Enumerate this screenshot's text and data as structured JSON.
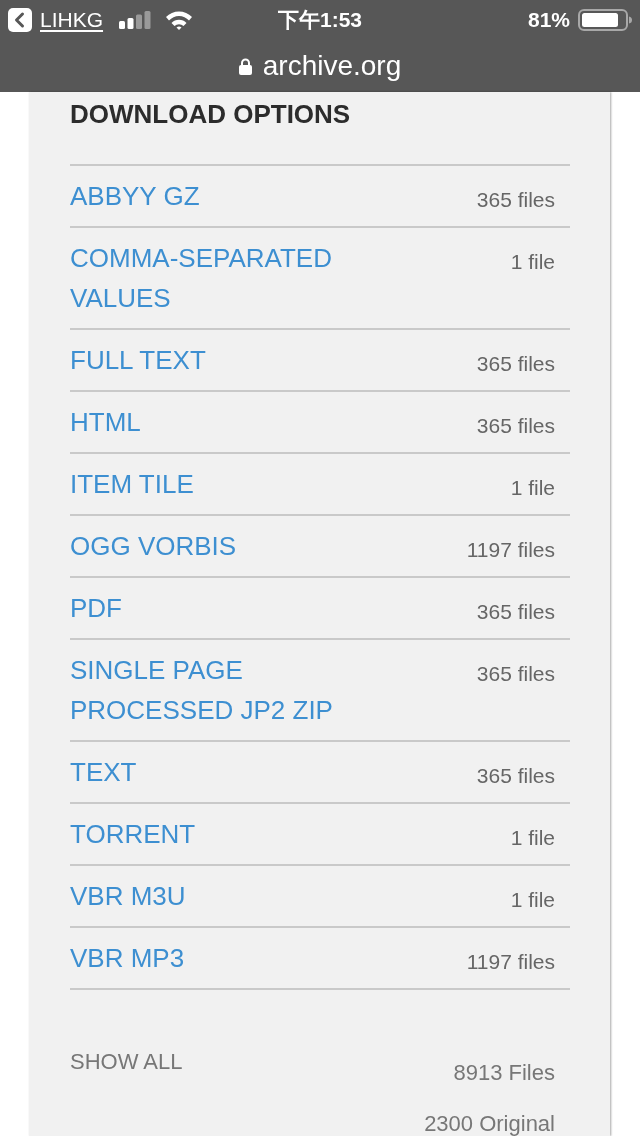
{
  "status_bar": {
    "back_label": "LIHKG",
    "time": "下午1:53",
    "battery": "81%"
  },
  "address_bar": {
    "url": "archive.org"
  },
  "download_options": {
    "title": "DOWNLOAD OPTIONS",
    "items": [
      {
        "name": "ABBYY GZ",
        "count": "365 files"
      },
      {
        "name": "COMMA-SEPARATED VALUES",
        "count": "1 file"
      },
      {
        "name": "FULL TEXT",
        "count": "365 files"
      },
      {
        "name": "HTML",
        "count": "365 files"
      },
      {
        "name": "ITEM TILE",
        "count": "1 file"
      },
      {
        "name": "OGG VORBIS",
        "count": "1197 files"
      },
      {
        "name": "PDF",
        "count": "365 files"
      },
      {
        "name": "SINGLE PAGE PROCESSED JP2 ZIP",
        "count": "365 files"
      },
      {
        "name": "TEXT",
        "count": "365 files"
      },
      {
        "name": "TORRENT",
        "count": "1 file"
      },
      {
        "name": "VBR M3U",
        "count": "1 file"
      },
      {
        "name": "VBR MP3",
        "count": "1197 files"
      }
    ],
    "show_all": {
      "label": "SHOW ALL",
      "totals": [
        "8913 Files",
        "2300 Original"
      ]
    }
  }
}
